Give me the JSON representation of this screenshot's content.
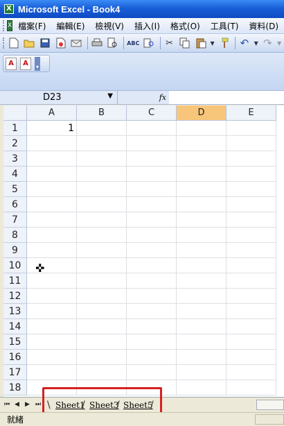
{
  "window": {
    "title": "Microsoft Excel - Book4"
  },
  "menu": {
    "items": [
      "檔案(F)",
      "編輯(E)",
      "檢視(V)",
      "插入(I)",
      "格式(O)",
      "工具(T)",
      "資料(D)"
    ]
  },
  "toolbar": {
    "icons": [
      "new-icon",
      "open-icon",
      "save-icon",
      "permission-icon",
      "email-icon",
      "print-icon",
      "print-preview-icon",
      "spelling-icon",
      "research-icon",
      "cut-icon",
      "copy-icon",
      "paste-icon",
      "format-painter-icon",
      "undo-icon",
      "redo-icon"
    ]
  },
  "pdf_toolbar": {
    "icons": [
      "pdf-convert-icon",
      "pdf-email-icon"
    ]
  },
  "formula_bar": {
    "name_box": "D23",
    "fx_label": "fx",
    "value": ""
  },
  "grid": {
    "columns": [
      "A",
      "B",
      "C",
      "D",
      "E"
    ],
    "active_column": "D",
    "rows": [
      "1",
      "2",
      "3",
      "4",
      "5",
      "6",
      "7",
      "8",
      "9",
      "10",
      "11",
      "12",
      "13",
      "14",
      "15",
      "16",
      "17",
      "18"
    ],
    "cells": {
      "A1": "1"
    }
  },
  "sheet_tabs": [
    "Sheet1",
    "Sheet3",
    "Sheet5"
  ],
  "status": {
    "text": "就緒"
  },
  "colors": {
    "active_header": "#f8c67a",
    "highlight_box": "#d62020",
    "title_bar": "#1a5fd8"
  }
}
